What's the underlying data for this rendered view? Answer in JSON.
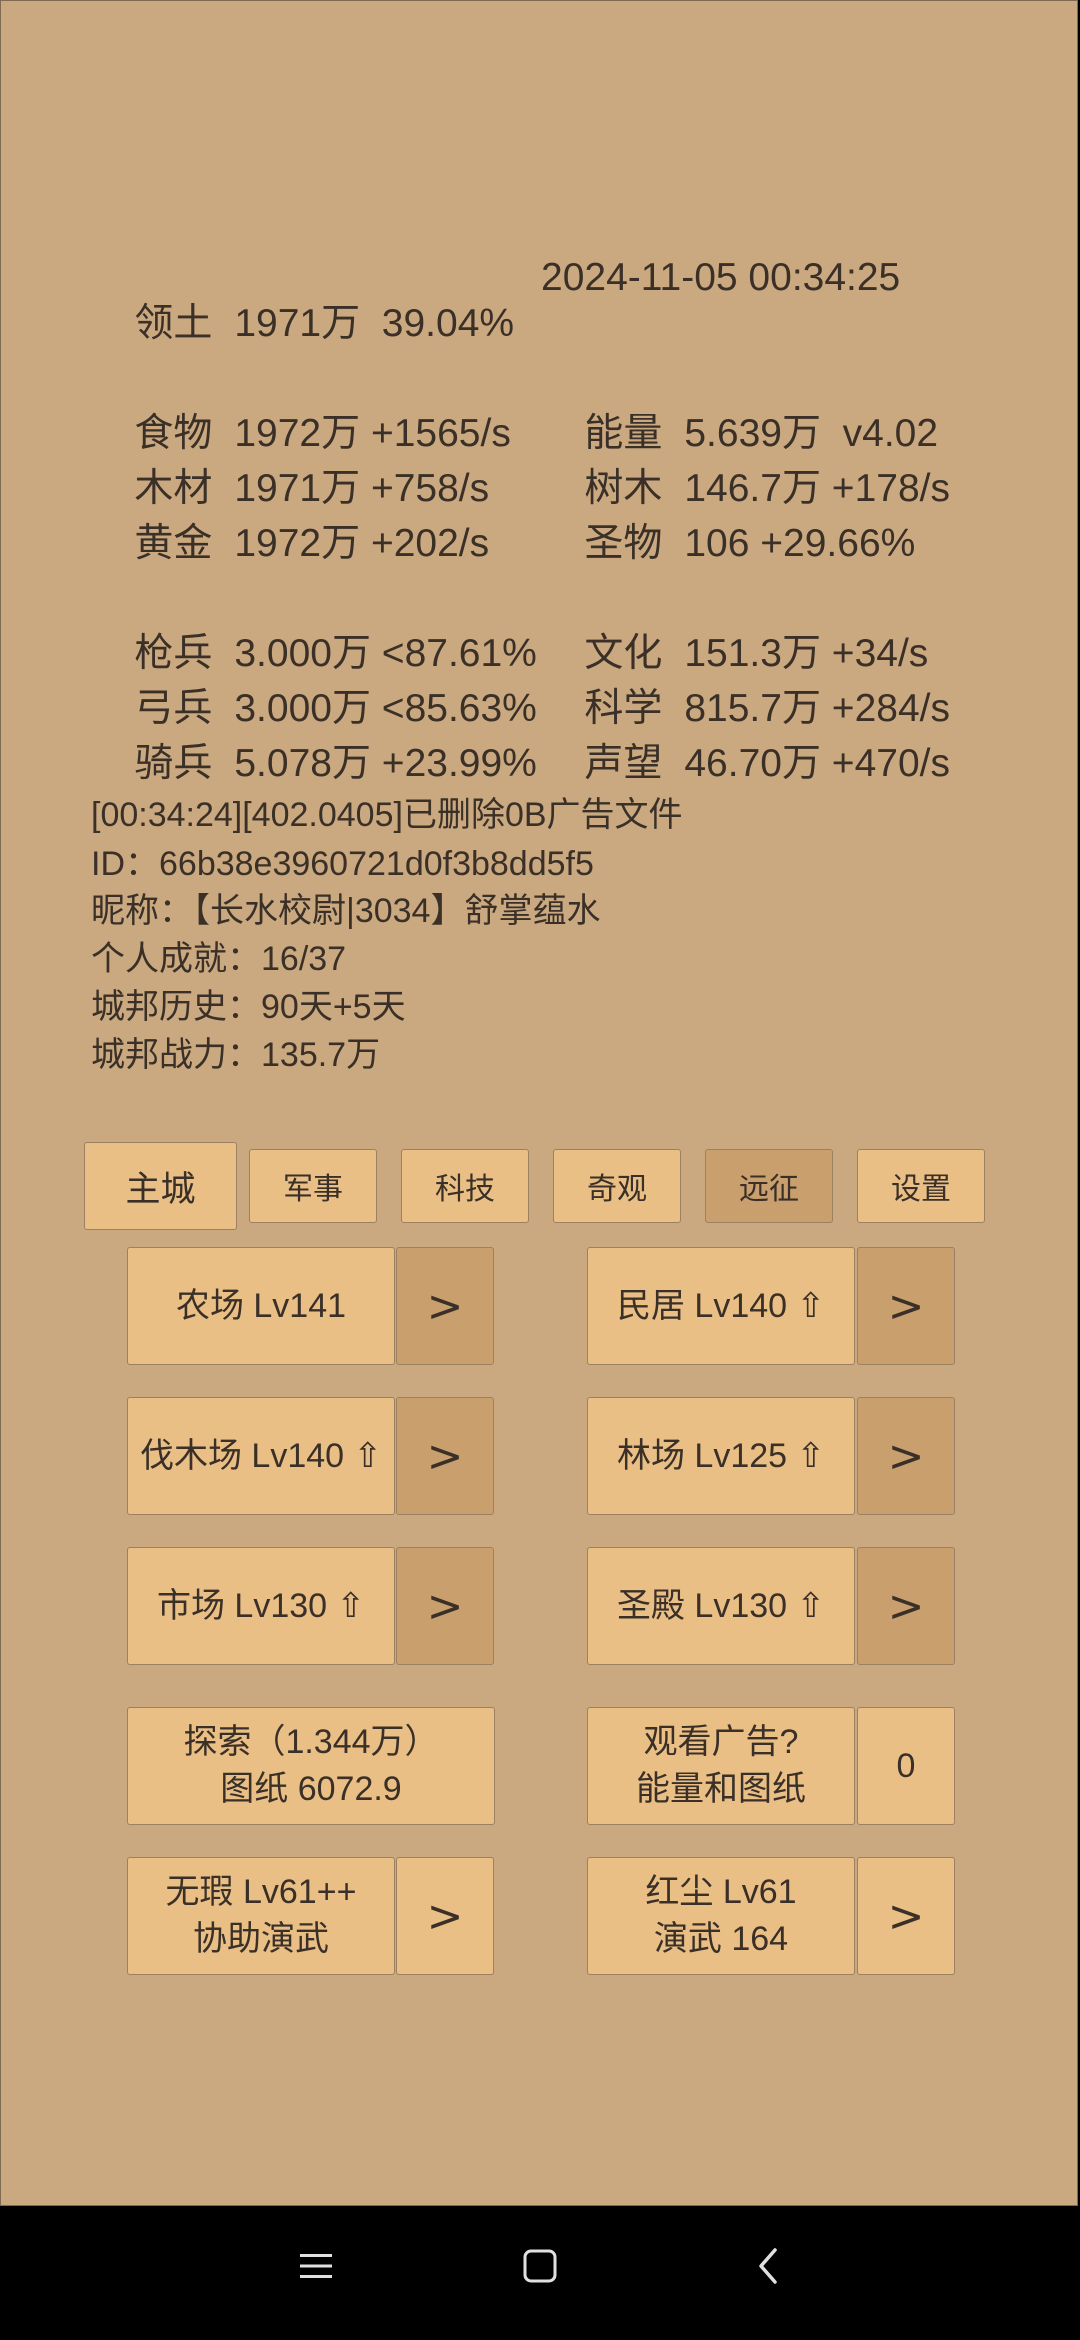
{
  "stats": {
    "territory": {
      "label": "领土",
      "value": "1971万  39.04%"
    },
    "datetime": "2024-11-05 00:34:25",
    "food": {
      "label": "食物",
      "value": "1972万 +1565/s"
    },
    "energy": {
      "label": "能量",
      "value": "5.639万  v4.02"
    },
    "wood": {
      "label": "木材",
      "value": "1971万 +758/s"
    },
    "trees": {
      "label": "树木",
      "value": "146.7万 +178/s"
    },
    "gold": {
      "label": "黄金",
      "value": "1972万 +202/s"
    },
    "relics": {
      "label": "圣物",
      "value": "106 +29.66%"
    },
    "spearmen": {
      "label": "枪兵",
      "value": "3.000万 <87.61%"
    },
    "culture": {
      "label": "文化",
      "value": "151.3万 +34/s"
    },
    "archers": {
      "label": "弓兵",
      "value": "3.000万 <85.63%"
    },
    "science": {
      "label": "科学",
      "value": "815.7万 +284/s"
    },
    "cavalry": {
      "label": "骑兵",
      "value": "5.078万 +23.99%"
    },
    "prestige": {
      "label": "声望",
      "value": "46.70万 +470/s"
    }
  },
  "info": {
    "log": "[00:34:24][402.0405]已删除0B广告文件",
    "id": "ID：66b38e3960721d0f3b8dd5f5",
    "nickname": "昵称：【长水校尉|3034】舒掌蕴水",
    "achievements": "个人成就：16/37",
    "history": "城邦历史：90天+5天",
    "power": "城邦战力：135.7万"
  },
  "tabs": [
    {
      "label": "主城",
      "selected": true
    },
    {
      "label": "军事"
    },
    {
      "label": "科技"
    },
    {
      "label": "奇观"
    },
    {
      "label": "远征"
    },
    {
      "label": "设置"
    }
  ],
  "buildings": {
    "farm": "农场 Lv141",
    "houses": "民居 Lv140 ⇧",
    "lumber": "伐木场 Lv140 ⇧",
    "forest": "林场 Lv125 ⇧",
    "market": "市场 Lv130 ⇧",
    "temple": "圣殿 Lv130 ⇧",
    "arrow": ">"
  },
  "actions": {
    "explore_line1": "探索（1.344万）",
    "explore_line2": "图纸 6072.9",
    "ad_line1": "观看广告?",
    "ad_line2": "能量和图纸",
    "ad_count": "0",
    "flawless_line1": "无瑕 Lv61++",
    "flawless_line2": "协助演武",
    "hongchen_line1": "红尘 Lv61",
    "hongchen_line2": "演武 164"
  },
  "nav": {
    "menu_icon": "menu-lines-icon",
    "home_icon": "home-square-icon",
    "back_icon": "back-chevron-icon"
  }
}
